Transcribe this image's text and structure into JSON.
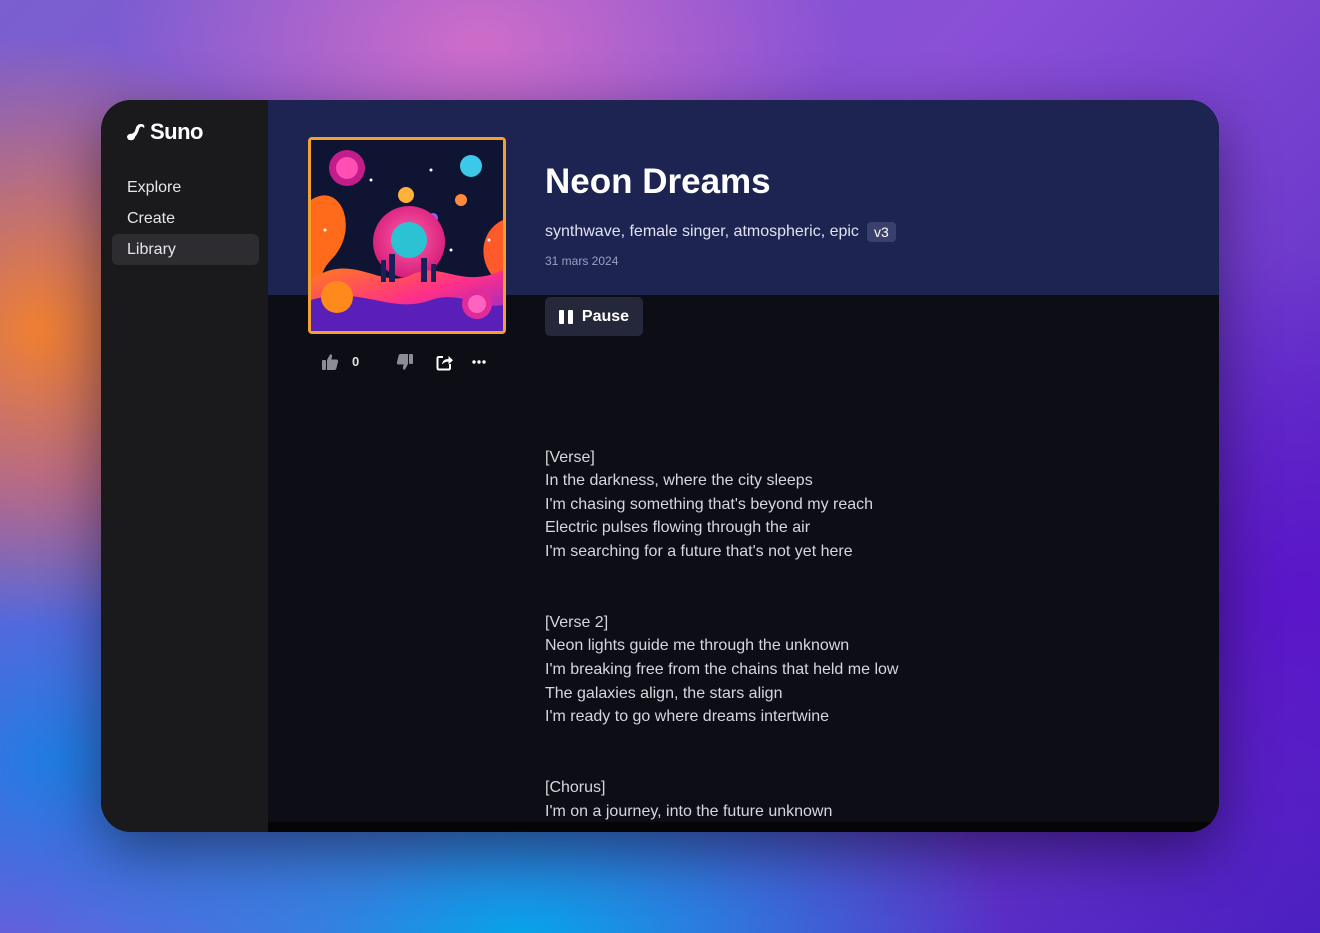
{
  "app": {
    "name": "Suno"
  },
  "sidebar": {
    "items": [
      {
        "label": "Explore"
      },
      {
        "label": "Create"
      },
      {
        "label": "Library"
      }
    ]
  },
  "song": {
    "title": "Neon Dreams",
    "tags": "synthwave, female singer, atmospheric, epic",
    "version": "v3",
    "date": "31 mars 2024",
    "likes": "0",
    "pause_label": "Pause"
  },
  "lyrics": [
    "[Verse]\nIn the darkness, where the city sleeps\nI'm chasing something that's beyond my reach\nElectric pulses flowing through the air\nI'm searching for a future that's not yet here",
    "[Verse 2]\nNeon lights guide me through the unknown\nI'm breaking free from the chains that held me low\nThe galaxies align, the stars align\nI'm ready to go where dreams intertwine",
    "[Chorus]\nI'm on a journey, into the future unknown\nA world of possibilities I call my own\nWith every step, I'm catching glimpses of a brand new day\nIn this neon dream, I'm finding my own way"
  ],
  "icons": {
    "logo": "suno-logo-icon",
    "like": "thumbs-up-icon",
    "dislike": "thumbs-down-icon",
    "share": "share-icon",
    "more": "more-options-icon",
    "pause": "pause-icon"
  },
  "colors": {
    "sidebar_bg": "#1a1a1c",
    "header_bg": "#1d2451",
    "main_bg": "#0c0d15",
    "cover_border": "#f3a12e",
    "badge_bg": "#39406b"
  }
}
